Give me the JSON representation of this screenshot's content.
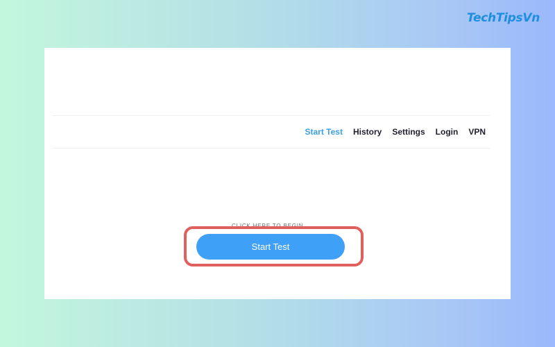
{
  "watermark": {
    "text": "TechTipsVn"
  },
  "nav": {
    "items": [
      {
        "label": "Start Test",
        "active": true
      },
      {
        "label": "History",
        "active": false
      },
      {
        "label": "Settings",
        "active": false
      },
      {
        "label": "Login",
        "active": false
      },
      {
        "label": "VPN",
        "active": false
      }
    ]
  },
  "main": {
    "begin_label": "CLICK HERE TO BEGIN",
    "start_button_label": "Start Test"
  },
  "colors": {
    "accent": "#3fa0f7",
    "active_nav": "#3d9ee0",
    "highlight_border": "#e0605e",
    "watermark": "#1f8ee0"
  }
}
